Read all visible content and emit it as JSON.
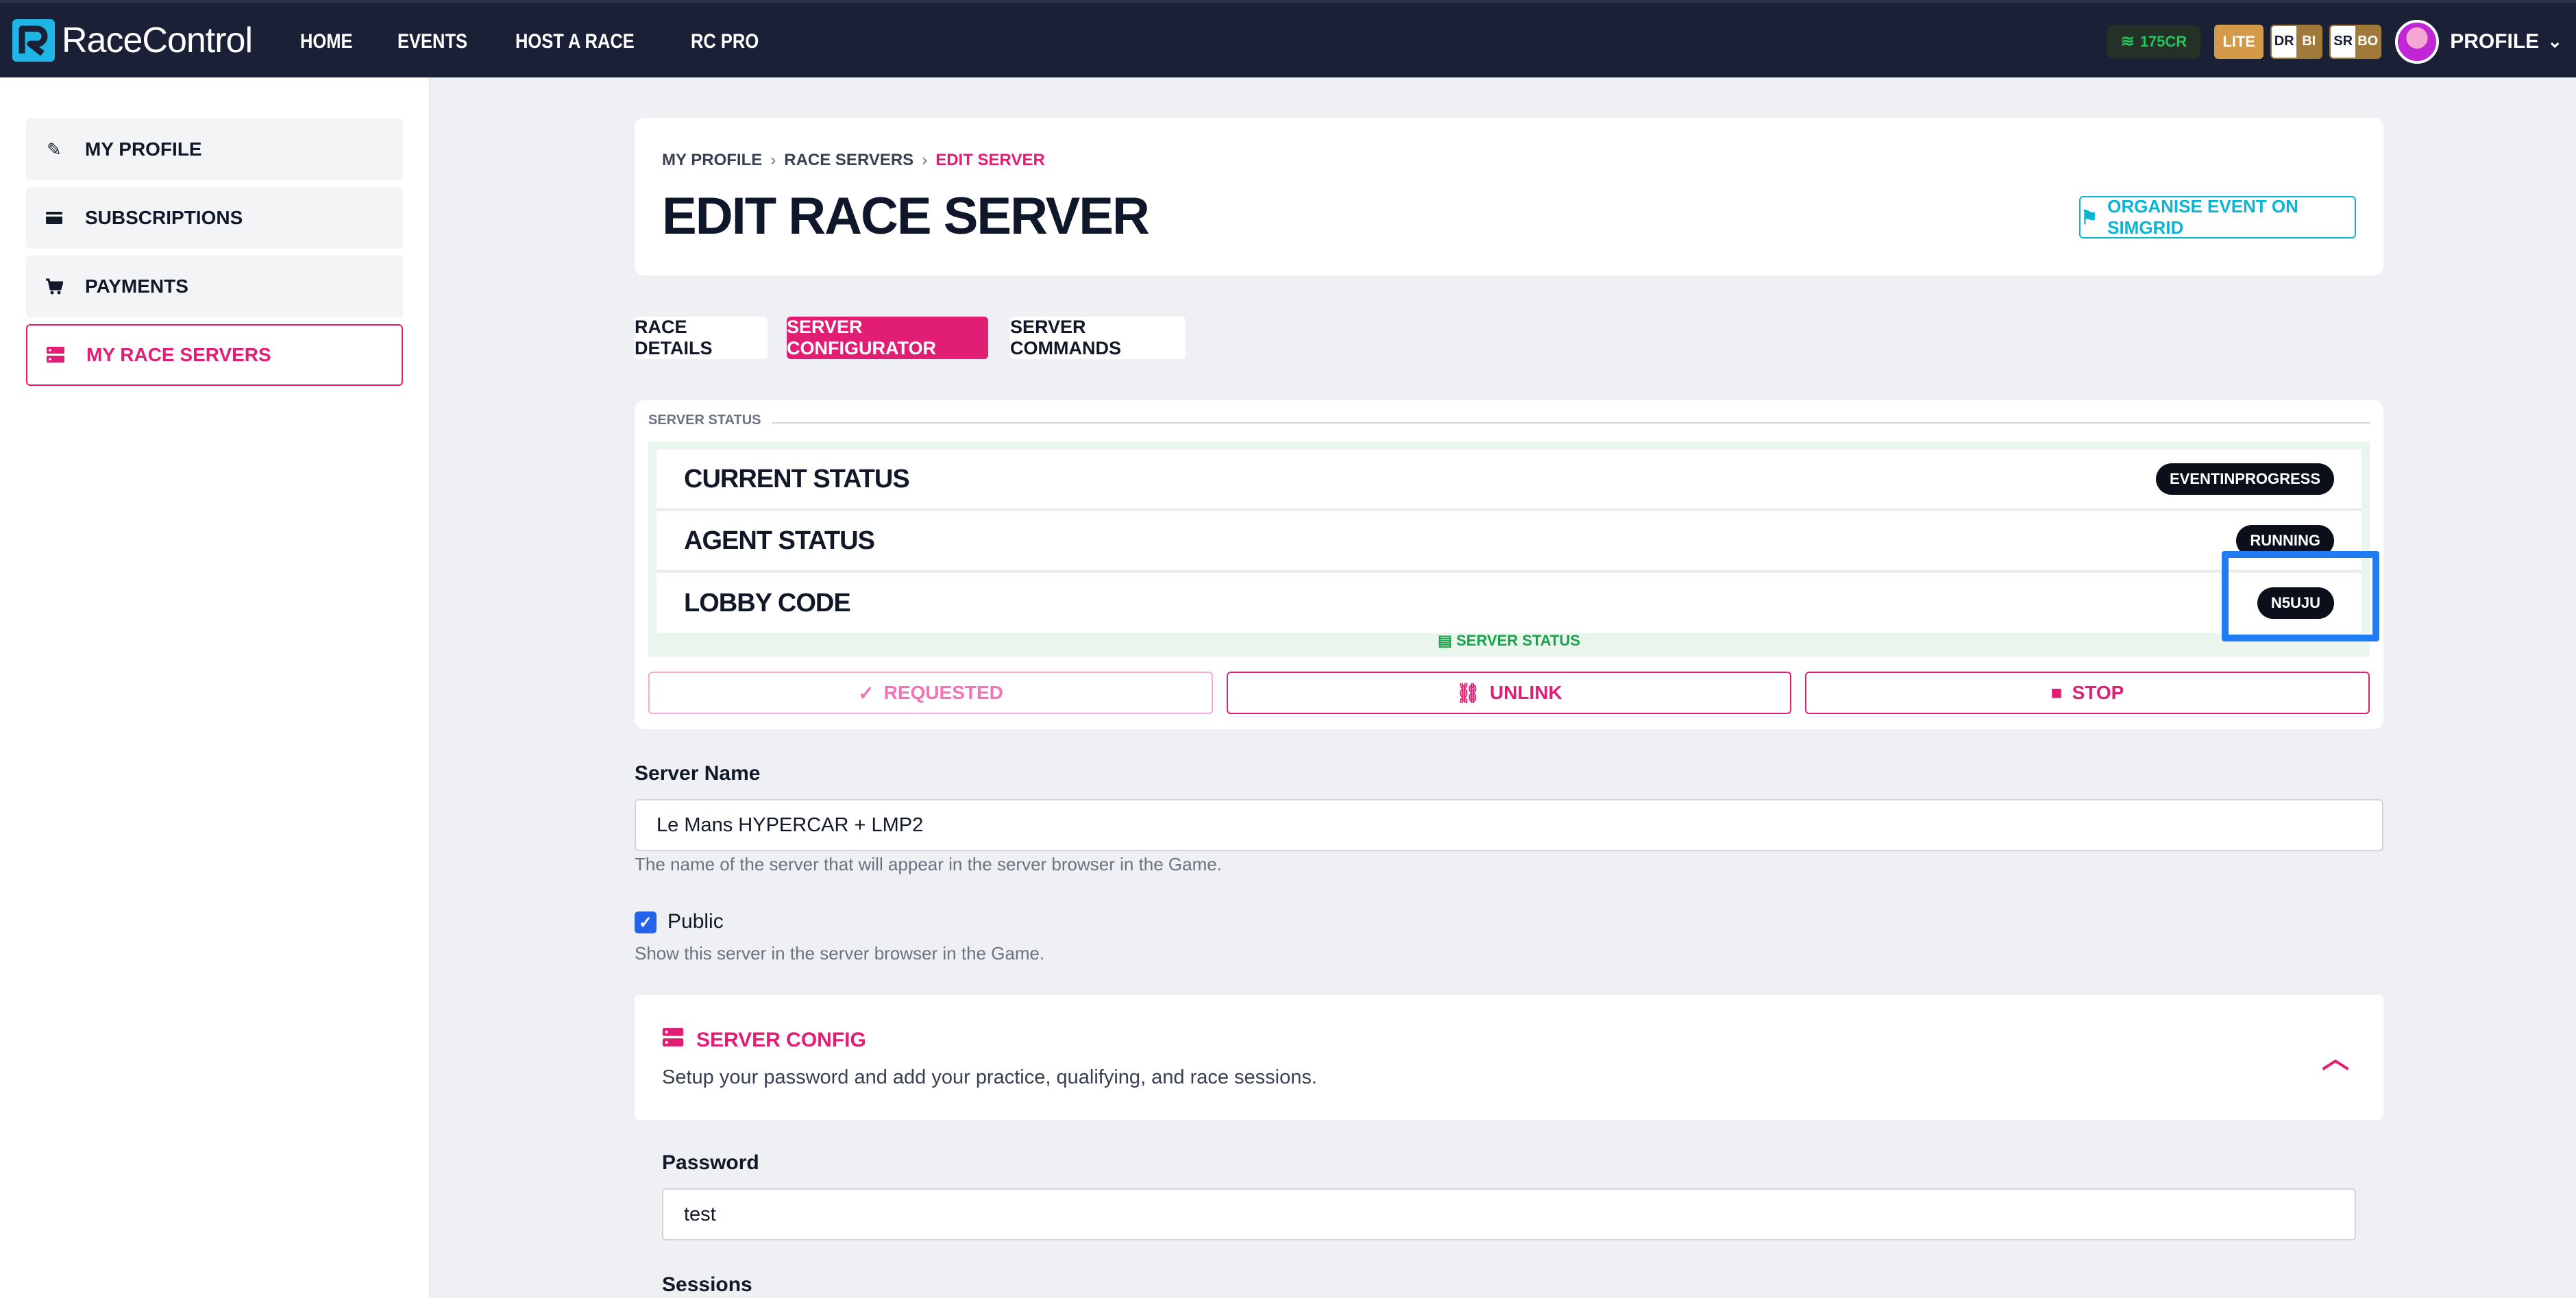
{
  "app": {
    "name": "RaceControl"
  },
  "nav": {
    "items": [
      "HOME",
      "EVENTS",
      "HOST A RACE",
      "RC PRO"
    ]
  },
  "topbar": {
    "credits": "175CR",
    "licence": "LITE",
    "dr": {
      "left": "DR",
      "right": "BI"
    },
    "sr": {
      "left": "SR",
      "right": "BO"
    },
    "profile_label": "PROFILE"
  },
  "sidebar": {
    "items": [
      {
        "label": "MY PROFILE",
        "icon": "pencil-icon"
      },
      {
        "label": "SUBSCRIPTIONS",
        "icon": "card-icon"
      },
      {
        "label": "PAYMENTS",
        "icon": "cart-icon"
      },
      {
        "label": "MY RACE SERVERS",
        "icon": "server-icon",
        "active": true
      }
    ]
  },
  "header": {
    "breadcrumb": [
      "MY PROFILE",
      "RACE SERVERS",
      "EDIT SERVER"
    ],
    "title": "EDIT RACE SERVER",
    "simgrid_button": "ORGANISE EVENT ON SIMGRID"
  },
  "tabs": [
    {
      "label": "RACE DETAILS",
      "active": false
    },
    {
      "label": "SERVER CONFIGURATOR",
      "active": true
    },
    {
      "label": "SERVER COMMANDS",
      "active": false
    }
  ],
  "server_status": {
    "legend": "SERVER STATUS",
    "rows": [
      {
        "name": "CURRENT STATUS",
        "value": "EVENTINPROGRESS"
      },
      {
        "name": "AGENT STATUS",
        "value": "RUNNING"
      },
      {
        "name": "LOBBY CODE",
        "value": "N5UJU"
      }
    ],
    "footer": "SERVER STATUS",
    "actions": {
      "requested": "REQUESTED",
      "unlink": "UNLINK",
      "stop": "STOP"
    }
  },
  "form": {
    "server_name_label": "Server Name",
    "server_name_value": "Le Mans HYPERCAR + LMP2",
    "server_name_help": "The name of the server that will appear in the server browser in the Game.",
    "public_label": "Public",
    "public_checked": true,
    "public_help": "Show this server in the server browser in the Game.",
    "config_title": "SERVER CONFIG",
    "config_subtitle": "Setup your password and add your practice, qualifying, and race sessions.",
    "password_label": "Password",
    "password_value": "test",
    "sessions_label": "Sessions"
  },
  "colors": {
    "accent": "#e11d74",
    "nav_bg": "#1a2036",
    "cyan": "#06b6d4",
    "highlight": "#1f7cf2"
  }
}
